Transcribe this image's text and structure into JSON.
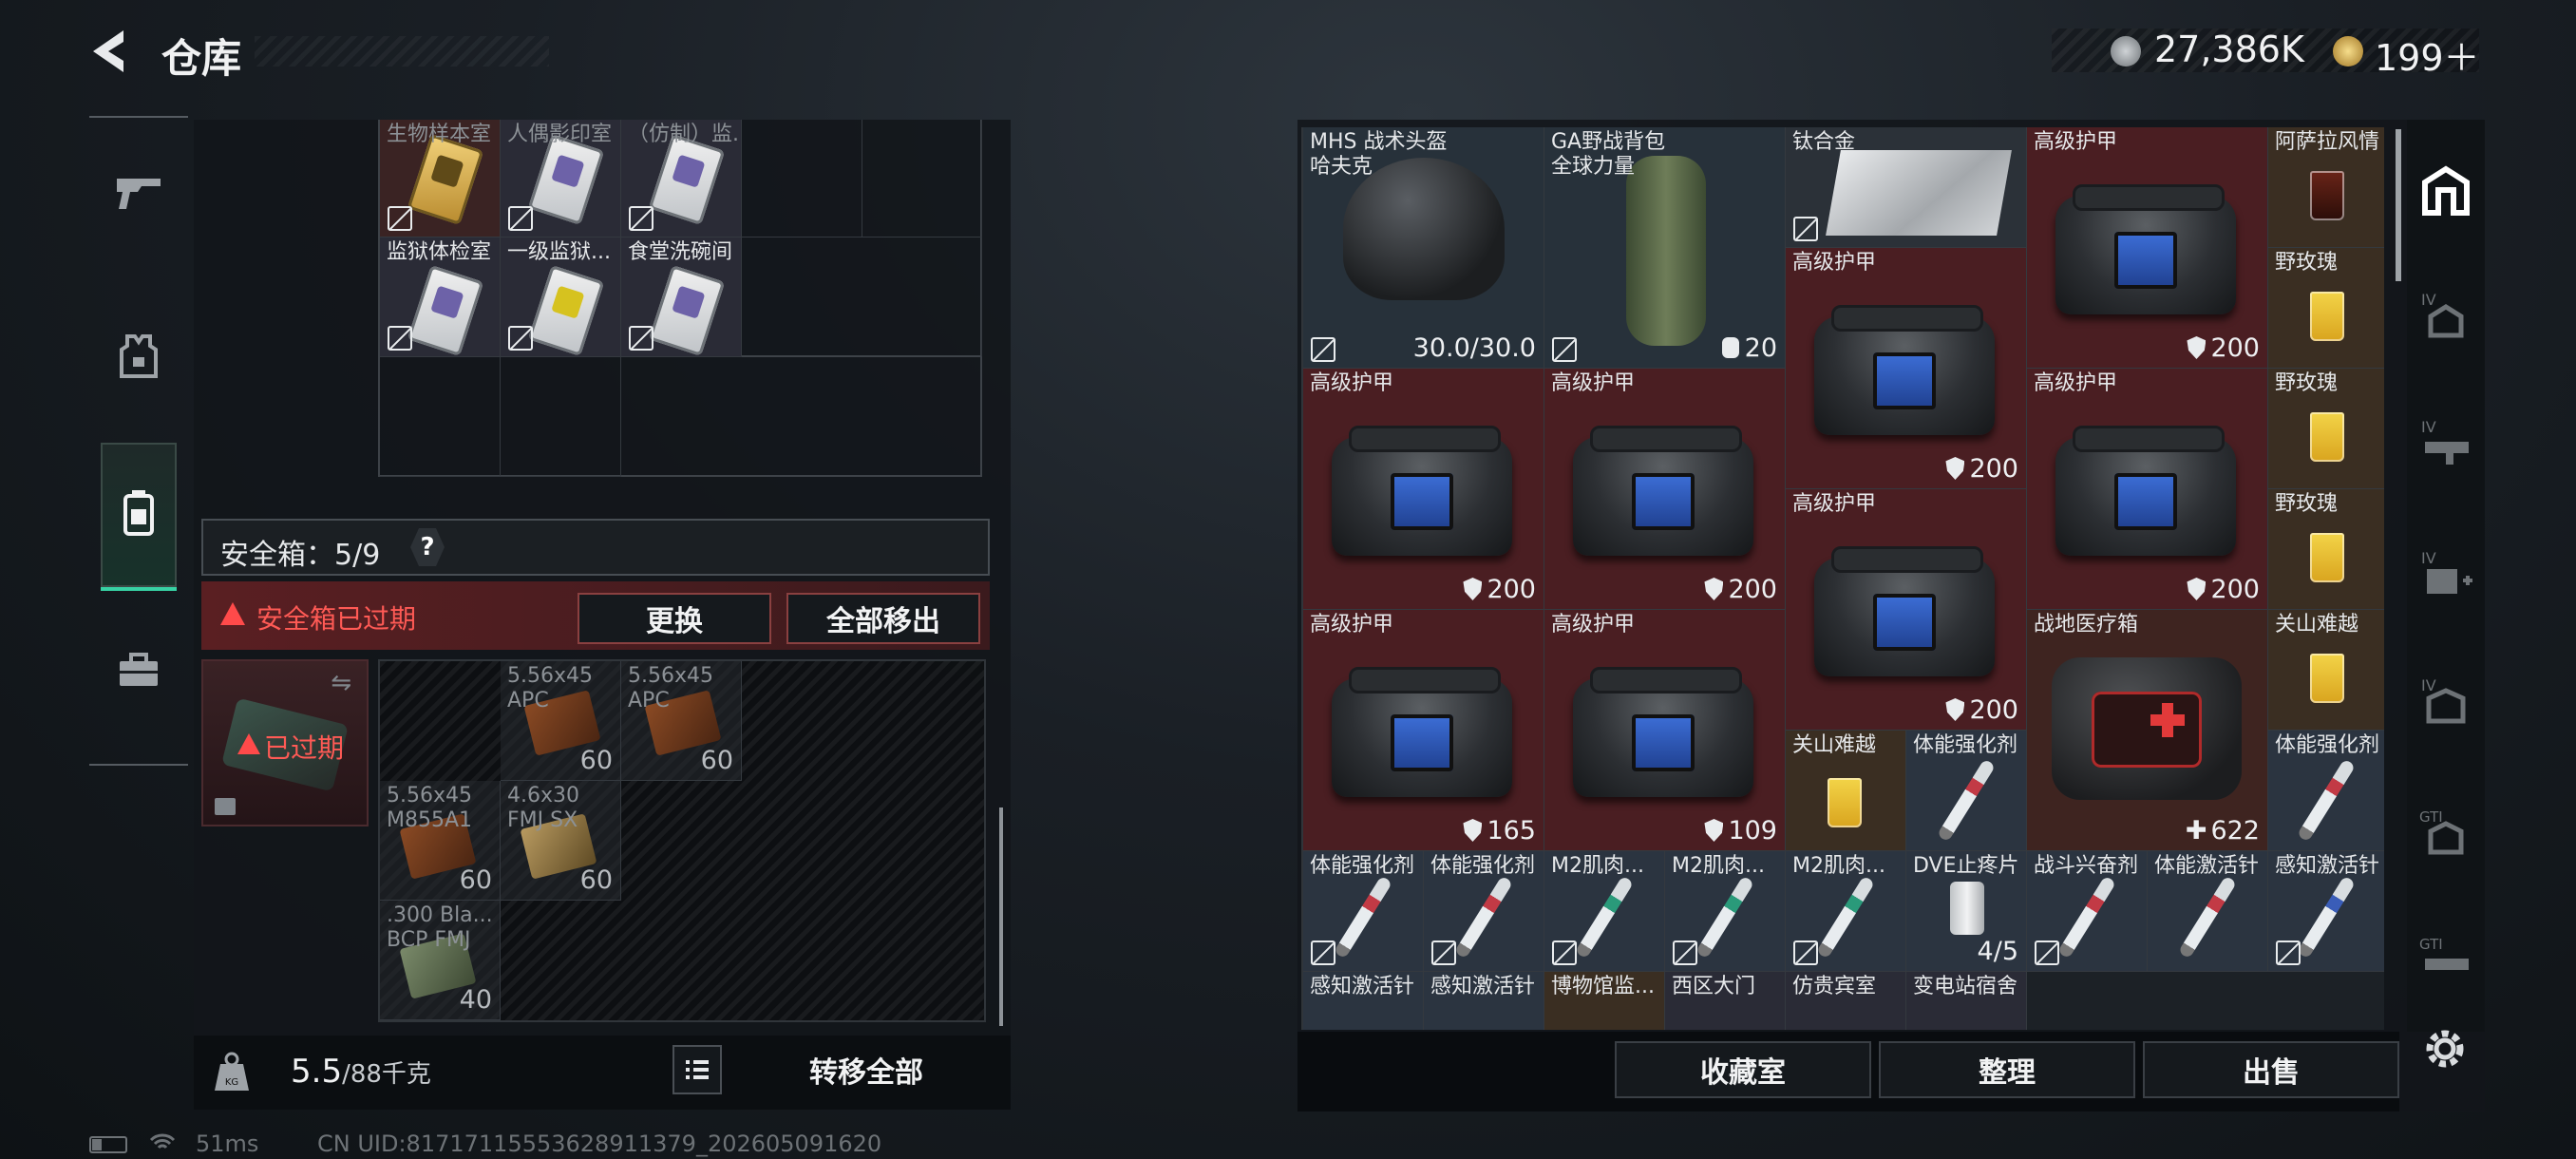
{
  "header": {
    "title": "仓库",
    "currency1": "27,386K",
    "currency2": "199＋"
  },
  "left": {
    "top_grid": [
      {
        "label": "生物样本室",
        "card": "gold"
      },
      {
        "label": "人偶影印室",
        "card": "purple"
      },
      {
        "label": "（仿制）监...",
        "card": "purple"
      },
      {
        "label": "监狱体检室",
        "card": "purple"
      },
      {
        "label": "一级监狱...",
        "card": "yellow"
      },
      {
        "label": "食堂洗碗间",
        "card": "purple"
      }
    ],
    "safebox_label": "安全箱：5/9",
    "help": "?",
    "expired_warning": "安全箱已过期",
    "replace_button": "更换",
    "remove_all_button": "全部移出",
    "case_expired": "已过期",
    "ammo": [
      {
        "l1": "5.56x45",
        "l2": "APC",
        "count": "60"
      },
      {
        "l1": "5.56x45",
        "l2": "APC",
        "count": "60"
      },
      {
        "l1": "5.56x45",
        "l2": "M855A1",
        "count": "60"
      },
      {
        "l1": "4.6x30",
        "l2": "FMJ SX",
        "count": "60"
      },
      {
        "l1": ".300 Bla...",
        "l2": "BCP FMJ",
        "count": "40"
      }
    ],
    "weight": "5.5",
    "weight_max": "/88千克",
    "transfer_all": "转移全部"
  },
  "stash": {
    "helmet": {
      "l1": "MHS 战术头盔",
      "l2": "哈夫克",
      "val": "30.0/30.0"
    },
    "backpack": {
      "l1": "GA野战背包",
      "l2": "全球力量",
      "val": "20"
    },
    "titanium": {
      "label": "钛合金"
    },
    "armor_label": "高级护甲",
    "armor_vals": {
      "a1": "200",
      "a2": "200",
      "a3": "200",
      "a4": "200",
      "a5": "200",
      "a6": "200",
      "a7": "165",
      "a8": "109",
      "a9": "200"
    },
    "drinks": {
      "d1": "阿萨拉风情",
      "d2": "野玫瑰",
      "d3": "野玫瑰",
      "d4": "野玫瑰",
      "d5": "关山难越",
      "d6": "关山难越"
    },
    "medkit": {
      "label": "战地医疗箱",
      "val": "622"
    },
    "row_syringes": [
      {
        "label": "体能强化剂"
      },
      {
        "label": "体能强化剂"
      },
      {
        "label": "M2肌肉..."
      },
      {
        "label": "M2肌肉..."
      },
      {
        "label": "M2肌肉..."
      },
      {
        "label": "DVE止疼片",
        "val": "4/5"
      },
      {
        "label": "战斗兴奋剂"
      },
      {
        "label": "体能激活针"
      },
      {
        "label": "感知激活针"
      }
    ],
    "syr_r4": {
      "label": "体能强化剂"
    },
    "syr_r5": {
      "label": "体能强化剂"
    },
    "bottom_row": [
      "感知激活针",
      "感知激活针",
      "博物馆监...",
      "西区大门",
      "仿贵宾室",
      "变电站宿舍"
    ],
    "buttons": {
      "collection": "收藏室",
      "organize": "整理",
      "sell": "出售"
    }
  },
  "status": {
    "ping": "51ms",
    "uid": "CN UID:8171711555362891137​9_202605091620"
  },
  "colors": {
    "armor_bg": "#4a1e22",
    "medical_bg": "#2b3440",
    "warning_red": "#e64040"
  }
}
